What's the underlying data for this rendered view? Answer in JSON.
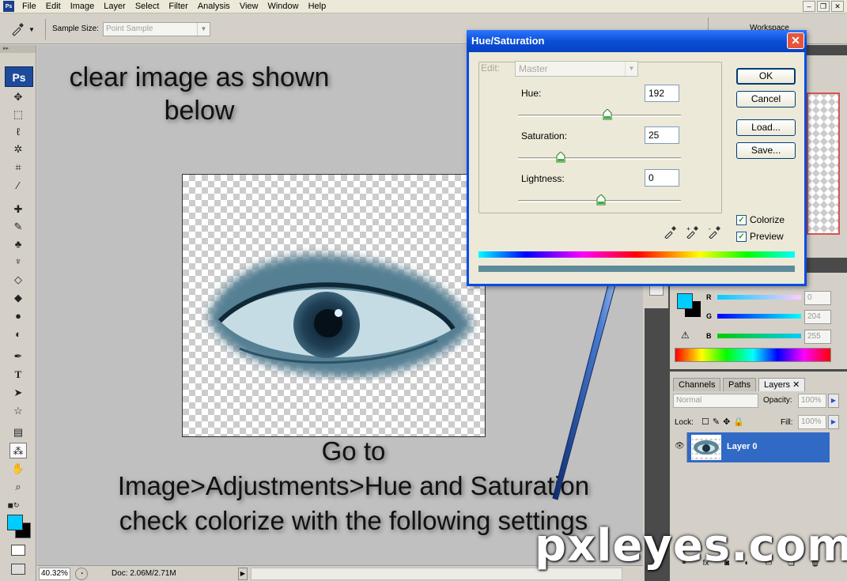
{
  "menubar": {
    "app_icon": "Ps",
    "items": [
      "File",
      "Edit",
      "Image",
      "Layer",
      "Select",
      "Filter",
      "Analysis",
      "View",
      "Window",
      "Help"
    ]
  },
  "options_bar": {
    "sample_size_label": "Sample Size:",
    "sample_size_value": "Point Sample",
    "workspace_label": "Workspace"
  },
  "tools": {
    "logo": "Ps"
  },
  "canvas": {
    "instruction_top": "clear image as shown below",
    "instruction_bottom_lines": [
      "Go to",
      "Image>Adjustments>Hue and Saturation",
      "check colorize with the following settings"
    ]
  },
  "status_bar": {
    "zoom": "40.32%",
    "doc_info": "Doc: 2.06M/2.71M"
  },
  "dialog": {
    "title": "Hue/Saturation",
    "edit_label": "Edit:",
    "edit_value": "Master",
    "hue_label": "Hue:",
    "hue_value": "192",
    "saturation_label": "Saturation:",
    "saturation_value": "25",
    "lightness_label": "Lightness:",
    "lightness_value": "0",
    "ok_label": "OK",
    "cancel_label": "Cancel",
    "load_label": "Load...",
    "save_label": "Save...",
    "colorize_label": "Colorize",
    "preview_label": "Preview",
    "colorize_checked": true,
    "preview_checked": true
  },
  "color_panel": {
    "r_label": "R",
    "g_label": "G",
    "b_label": "B",
    "r_value": "0",
    "g_value": "204",
    "b_value": "255"
  },
  "layers_panel": {
    "tabs": [
      "Channels",
      "Paths",
      "Layers"
    ],
    "active_tab": "Layers",
    "blend_mode": "Normal",
    "opacity_label": "Opacity:",
    "opacity_value": "100%",
    "lock_label": "Lock:",
    "fill_label": "Fill:",
    "fill_value": "100%",
    "layer_name": "Layer 0"
  },
  "watermark": "pxleyes.com",
  "colors": {
    "foreground": "#00ccff",
    "background": "#000000",
    "selection": "#316ac5",
    "dialog_title": "#0a4fd8"
  }
}
